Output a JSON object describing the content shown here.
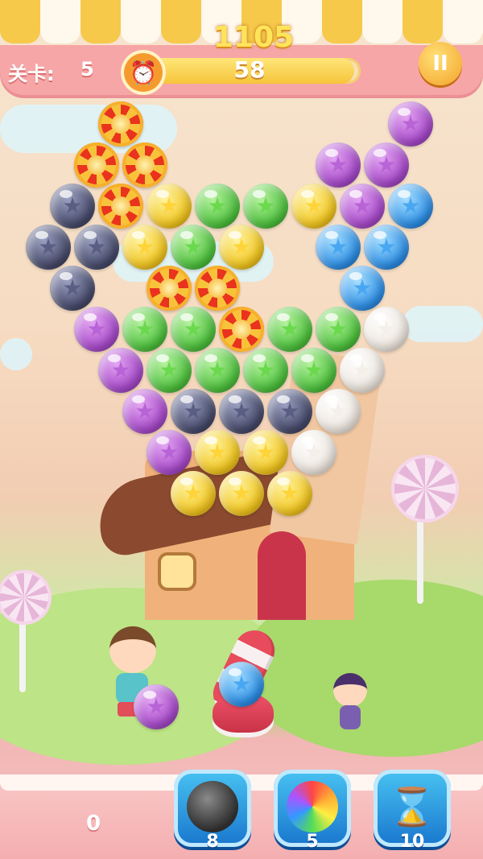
{
  "hud": {
    "level_label": "关卡:",
    "level_value": "5",
    "score": "1105",
    "timer_value": "58",
    "timer_fraction": 0.97,
    "pause_label": "II"
  },
  "board": {
    "rows": [
      [
        "swirl",
        null,
        null,
        null,
        null,
        null,
        "purple",
        null
      ],
      [
        "swirl",
        "swirl",
        null,
        null,
        null,
        "purple",
        "purple",
        null
      ],
      [
        "dark",
        "swirl",
        "yellow",
        "green",
        "green",
        "yellow",
        "purple",
        "blue"
      ],
      [
        "dark",
        "dark",
        "yellow",
        "green",
        "yellow",
        null,
        "blue",
        "blue"
      ],
      [
        "dark",
        null,
        "swirl",
        "swirl",
        null,
        null,
        "blue",
        null
      ],
      [
        "purple",
        "green",
        "green",
        "swirl",
        "green",
        "green",
        "white",
        null
      ],
      [
        "purple",
        "green",
        "green",
        "green",
        "green",
        "white",
        null,
        null
      ],
      [
        "purple",
        "dark",
        "dark",
        "dark",
        "white",
        null,
        null,
        null
      ],
      [
        "purple",
        "yellow",
        "yellow",
        "white",
        null,
        null,
        null,
        null
      ],
      [
        "yellow",
        "yellow",
        "yellow",
        null,
        null,
        null,
        null,
        null
      ]
    ]
  },
  "shooter": {
    "loaded_bubble": "blue",
    "next_bubble": "purple"
  },
  "bottom": {
    "counter": "0",
    "powerups": [
      {
        "name": "bomb",
        "count": "8"
      },
      {
        "name": "rainbow",
        "count": "5"
      },
      {
        "name": "hourglass",
        "count": "10"
      }
    ]
  },
  "colors": {
    "purple": "#a549c8",
    "green": "#4cbf3c",
    "yellow": "#f0c41e",
    "blue": "#2d8ee4",
    "dark": "#474a6a",
    "white": "#ebe4dc",
    "swirl": "#e9331e"
  }
}
